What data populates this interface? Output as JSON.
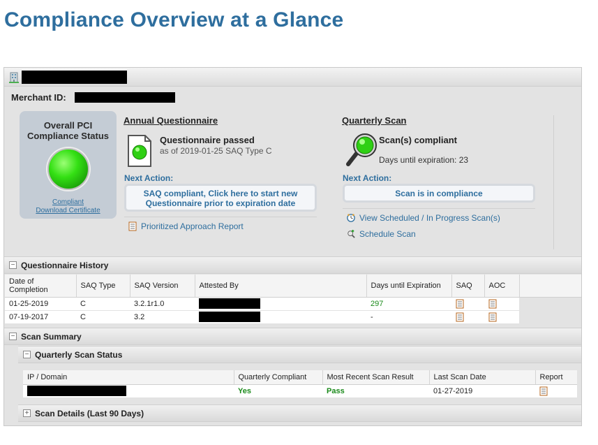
{
  "page": {
    "title": "Compliance Overview at a Glance"
  },
  "merchant": {
    "label": "Merchant ID:"
  },
  "status": {
    "title": "Overall PCI Compliance Status",
    "link_compliant": "Compliant",
    "link_certificate": "Download Certificate",
    "color": "#34e014"
  },
  "annual": {
    "heading": "Annual Questionnaire",
    "result": "Questionnaire passed",
    "as_of": "as of 2019-01-25 SAQ Type C",
    "next_action_label": "Next Action:",
    "action_button": "SAQ compliant, Click here to start new Questionnaire prior to expiration date",
    "report_link": "Prioritized Approach Report"
  },
  "quarterly": {
    "heading": "Quarterly Scan",
    "result": "Scan(s) compliant",
    "expiration": "Days until expiration: 23",
    "next_action_label": "Next Action:",
    "action_button": "Scan is in compliance",
    "link_view": "View Scheduled / In Progress Scan(s)",
    "link_schedule": "Schedule Scan"
  },
  "questionnaire_history": {
    "title": "Questionnaire History",
    "toggle": "−",
    "columns": [
      "Date of Completion",
      "SAQ Type",
      "SAQ Version",
      "Attested By",
      "Days until Expiration",
      "SAQ",
      "AOC"
    ],
    "rows": [
      {
        "date": "01-25-2019",
        "type": "C",
        "version": "3.2.1r1.0",
        "days": "297"
      },
      {
        "date": "07-19-2017",
        "type": "C",
        "version": "3.2",
        "days": "-"
      }
    ]
  },
  "scan_summary": {
    "title": "Scan Summary",
    "toggle": "−",
    "quarterly_status": {
      "title": "Quarterly Scan Status",
      "toggle": "−",
      "columns": [
        "IP / Domain",
        "Quarterly Compliant",
        "Most Recent Scan Result",
        "Last Scan Date",
        "Report"
      ],
      "rows": [
        {
          "compliant": "Yes",
          "result": "Pass",
          "date": "01-27-2019"
        }
      ]
    },
    "details": {
      "title": "Scan Details (Last 90 Days)",
      "toggle": "+"
    }
  }
}
